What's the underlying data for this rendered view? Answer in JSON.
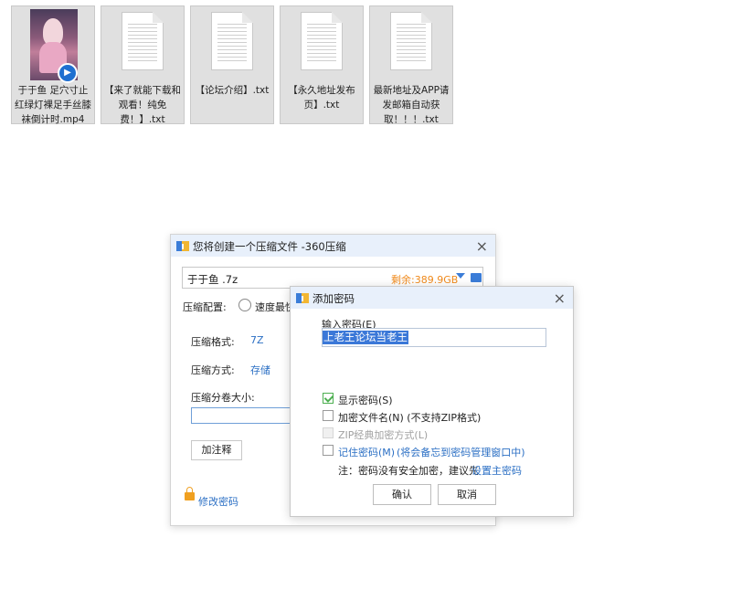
{
  "files": [
    {
      "name": "于于鱼 足穴寸止红绿灯裸足手丝膝袜倒计时.mp4",
      "type": "video"
    },
    {
      "name": "【来了就能下载和观看！纯免费！】.txt",
      "type": "txt"
    },
    {
      "name": "【论坛介绍】.txt",
      "type": "txt"
    },
    {
      "name": "【永久地址发布页】.txt",
      "type": "txt"
    },
    {
      "name": "最新地址及APP请发邮箱自动获取！！！.txt",
      "type": "txt"
    }
  ],
  "compress_dialog": {
    "title": "您将创建一个压缩文件 -360压缩",
    "close_icon": "×",
    "filename": "于于鱼 .7z",
    "free_space": "剩余:389.9GB",
    "config_label": "压缩配置:",
    "config_option": "速度最快",
    "format_label": "压缩格式:",
    "format_value": "7Z",
    "method_label": "压缩方式:",
    "method_value": "存储",
    "volume_label": "压缩分卷大小:",
    "volume_value": "",
    "comment_button": "加注释",
    "modify_password": "修改密码"
  },
  "password_dialog": {
    "title": "添加密码",
    "close_icon": "×",
    "input_label": "输入密码(E)",
    "password_value": "上老王论坛当老王",
    "show_password": "显示密码(S)",
    "encrypt_filenames": "加密文件名(N) (不支持ZIP格式)",
    "zip_classic": "ZIP经典加密方式(L)",
    "remember_password": "记住密码(M)",
    "remember_note": "(将会备忘到密码管理窗口中)",
    "note_prefix": "注：密码没有安全加密，建议先",
    "note_link": "设置主密码",
    "ok_button": "确认",
    "cancel_button": "取消"
  },
  "colors": {
    "accent": "#2b6fc4",
    "free_space": "#f08a1c",
    "selection": "#3b78d8"
  }
}
